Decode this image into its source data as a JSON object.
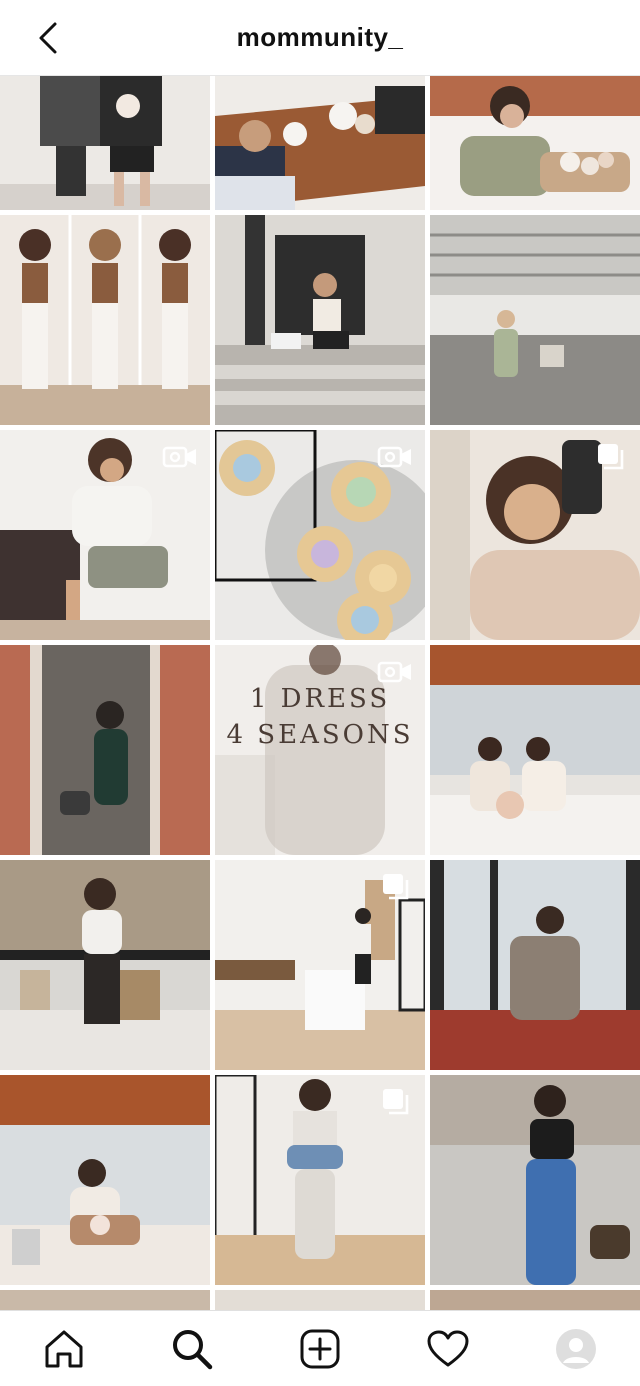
{
  "header": {
    "username": "mommunity_",
    "back_icon": "chevron-left-icon"
  },
  "grid": {
    "posts": [
      {
        "scene": "kids",
        "badge": null
      },
      {
        "scene": "table",
        "badge": null
      },
      {
        "scene": "bed",
        "badge": null
      },
      {
        "scene": "triptych",
        "badge": null
      },
      {
        "scene": "stairs",
        "badge": null
      },
      {
        "scene": "garage",
        "badge": null
      },
      {
        "scene": "sweater",
        "badge": "video"
      },
      {
        "scene": "nests",
        "badge": "video"
      },
      {
        "scene": "selfie",
        "badge": "carousel"
      },
      {
        "scene": "orange-door",
        "badge": null
      },
      {
        "scene": "dress",
        "badge": "video",
        "overlay_line1": "1 DRESS",
        "overlay_line2": "4 SEASONS"
      },
      {
        "scene": "bed-two",
        "badge": null
      },
      {
        "scene": "patio",
        "badge": null
      },
      {
        "scene": "kitchen",
        "badge": "carousel"
      },
      {
        "scene": "window",
        "badge": null
      },
      {
        "scene": "bouquet",
        "badge": null
      },
      {
        "scene": "hallway",
        "badge": "carousel"
      },
      {
        "scene": "jeans",
        "badge": null
      }
    ]
  },
  "bottom_nav": {
    "items": [
      "home-icon",
      "search-icon",
      "add-post-icon",
      "activity-heart-icon",
      "profile-avatar"
    ],
    "active": "search-icon"
  },
  "colors": {
    "accent": "#111111",
    "divider": "#e0e0e0"
  }
}
